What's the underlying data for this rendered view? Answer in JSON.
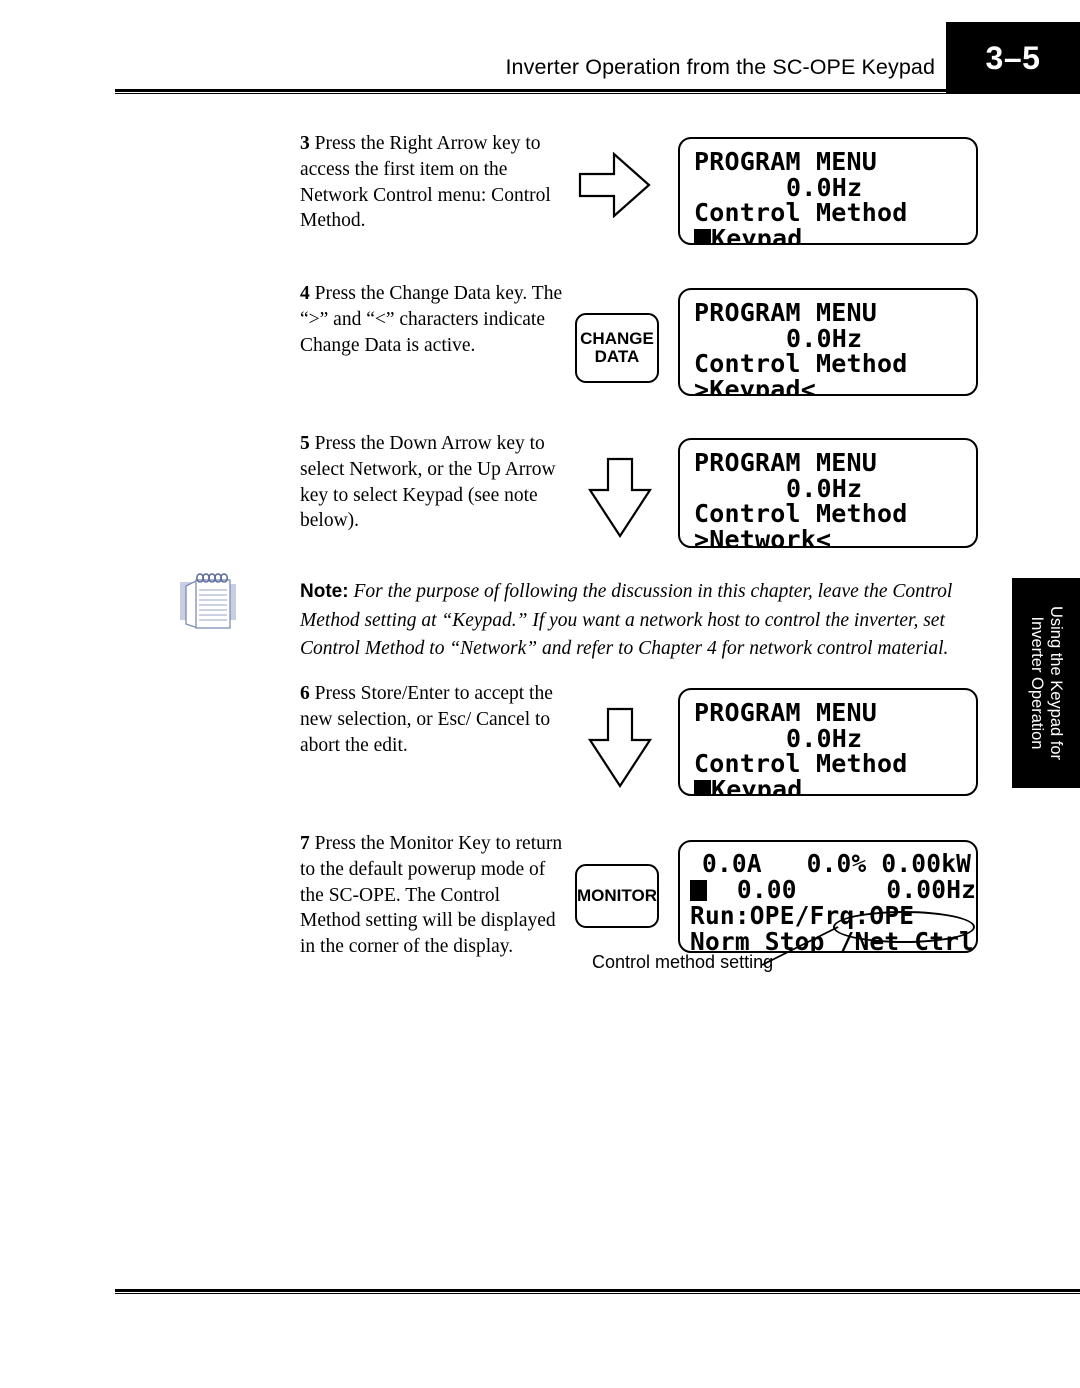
{
  "header": {
    "title": "Inverter Operation from the SC-OPE Keypad",
    "page_number": "3–5"
  },
  "side_tab": {
    "line1": "Using the Keypad for",
    "line2": "Inverter Operation"
  },
  "steps": [
    {
      "number": "3",
      "text": "Press the Right Arrow key to access the first item on the Network Control menu: Control Method.",
      "graphic": "arrow-right"
    },
    {
      "number": "4",
      "text": "Press the Change Data key. The “>” and “<” characters indicate Change Data is active.",
      "graphic": "key-change-data"
    },
    {
      "number": "5",
      "text": "Press the Down Arrow key to select Network, or the Up Arrow key to select Keypad (see note below).",
      "graphic": "arrow-down"
    },
    {
      "number": "6",
      "text": "Press Store/Enter to accept the new selection, or Esc/ Cancel to abort the edit.",
      "graphic": "arrow-down"
    },
    {
      "number": "7",
      "text": "Press the Monitor Key to return to the default powerup mode of the SC-OPE. The Control Method setting will be displayed in the corner of the display.",
      "graphic": "key-monitor"
    }
  ],
  "keys": {
    "change_data_line1": "CHANGE",
    "change_data_line2": "DATA",
    "monitor": "MONITOR"
  },
  "displays": {
    "step3": {
      "line1": "PROGRAM MENU",
      "line2": "0.0Hz",
      "line3": "Control Method",
      "line4_cursor": "block",
      "line4": "Keypad"
    },
    "step4": {
      "line1": "PROGRAM MENU",
      "line2": "0.0Hz",
      "line3": "Control Method",
      "line4": ">Keypad<"
    },
    "step5": {
      "line1": "PROGRAM MENU",
      "line2": "0.0Hz",
      "line3": "Control Method",
      "line4": ">Network<"
    },
    "step6": {
      "line1": "PROGRAM MENU",
      "line2": "0.0Hz",
      "line3": "Control Method",
      "line4_cursor": "block",
      "line4": "Keypad"
    },
    "monitor": {
      "line1": "0.0A   0.0% 0.00kW",
      "line2_cursor": "block",
      "line2": "  0.00      0.00Hz",
      "line3": "Run:OPE/Frq:OPE",
      "line4a": "Norm Stop /",
      "line4b": "Net Ctrl"
    }
  },
  "callout": {
    "label": "Control method setting"
  },
  "note": {
    "label": "Note:",
    "text": " For the purpose of following the discussion in this chapter, leave the Control Method setting at “Keypad.” If you want a network host to control the inverter, set Control Method to “Network” and refer to Chapter 4 for network control material."
  }
}
